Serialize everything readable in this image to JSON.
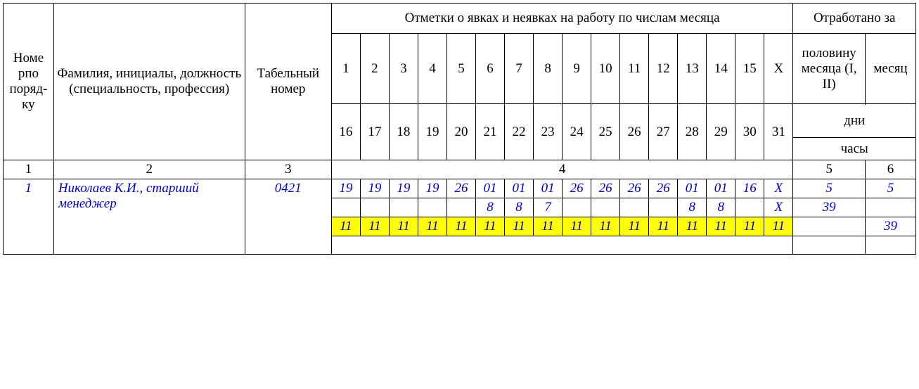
{
  "headers": {
    "c1": "Номе рпо поряд-ку",
    "c2": "Фамилия, инициалы, должность (специальность, профессия)",
    "c3": "Табельный номер",
    "c4_top": "Отметки о явках и неявках на работу по числам месяца",
    "c5_top": "Отработано за",
    "day_row1": [
      "1",
      "2",
      "3",
      "4",
      "5",
      "6",
      "7",
      "8",
      "9",
      "10",
      "11",
      "12",
      "13",
      "14",
      "15",
      "X"
    ],
    "day_row2": [
      "16",
      "17",
      "18",
      "19",
      "20",
      "21",
      "22",
      "23",
      "24",
      "25",
      "26",
      "27",
      "28",
      "29",
      "30",
      "31"
    ],
    "c5_sub": "половину месяца (I, II)",
    "c6_sub": "месяц",
    "days_label": "дни",
    "hours_label": "часы",
    "colnums": {
      "c1": "1",
      "c2": "2",
      "c3": "3",
      "c4": "4",
      "c5": "5",
      "c6": "6"
    }
  },
  "row": {
    "num": "1",
    "name": "Николаев К.И., старший менеджер",
    "tab": "0421",
    "r1": [
      "19",
      "19",
      "19",
      "19",
      "26",
      "01",
      "01",
      "01",
      "26",
      "26",
      "26",
      "26",
      "01",
      "01",
      "16",
      "X"
    ],
    "r2": [
      "",
      "",
      "",
      "",
      "",
      "8",
      "8",
      "7",
      "",
      "",
      "",
      "",
      "8",
      "8",
      "",
      "X"
    ],
    "r3": [
      "11",
      "11",
      "11",
      "11",
      "11",
      "11",
      "11",
      "11",
      "11",
      "11",
      "11",
      "11",
      "11",
      "11",
      "11",
      "11"
    ],
    "half_r1": "5",
    "month_r1": "5",
    "half_r2": "39",
    "month_r2": "",
    "half_r3": "",
    "month_r3": "39"
  }
}
